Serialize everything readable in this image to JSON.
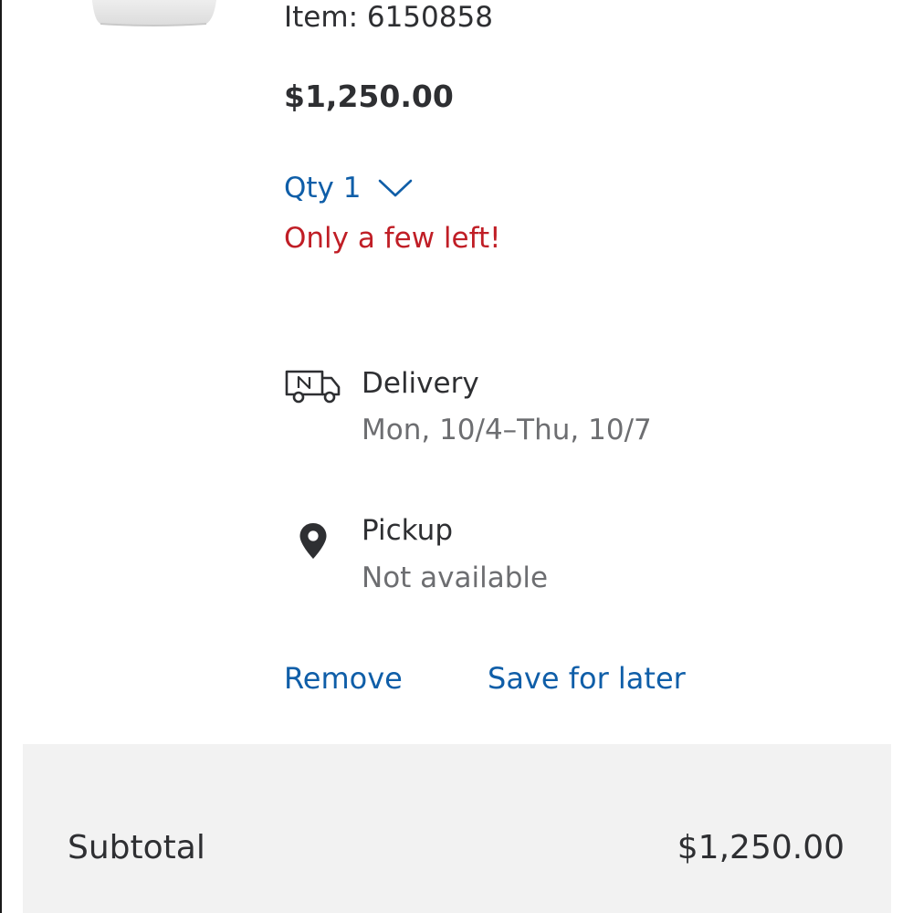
{
  "cart_item": {
    "item_number": "Item: 6150858",
    "price": "$1,250.00",
    "quantity_label": "Qty 1",
    "stock_message": "Only a few left!",
    "thumbnail_icon": "product-image"
  },
  "fulfillment": {
    "delivery": {
      "icon": "delivery-truck-icon",
      "title": "Delivery",
      "detail": "Mon, 10/4–Thu, 10/7"
    },
    "pickup": {
      "icon": "location-pin-icon",
      "title": "Pickup",
      "detail": "Not available"
    }
  },
  "actions": {
    "remove_label": "Remove",
    "save_for_later_label": "Save for later"
  },
  "summary": {
    "subtotal_label": "Subtotal",
    "subtotal_value": "$1,250.00"
  },
  "colors": {
    "link_blue": "#0f5ea8",
    "alert_red": "#c01e26",
    "text_dark": "#2e2f32",
    "text_muted": "#6d6e71",
    "panel_gray": "#f2f2f2"
  }
}
